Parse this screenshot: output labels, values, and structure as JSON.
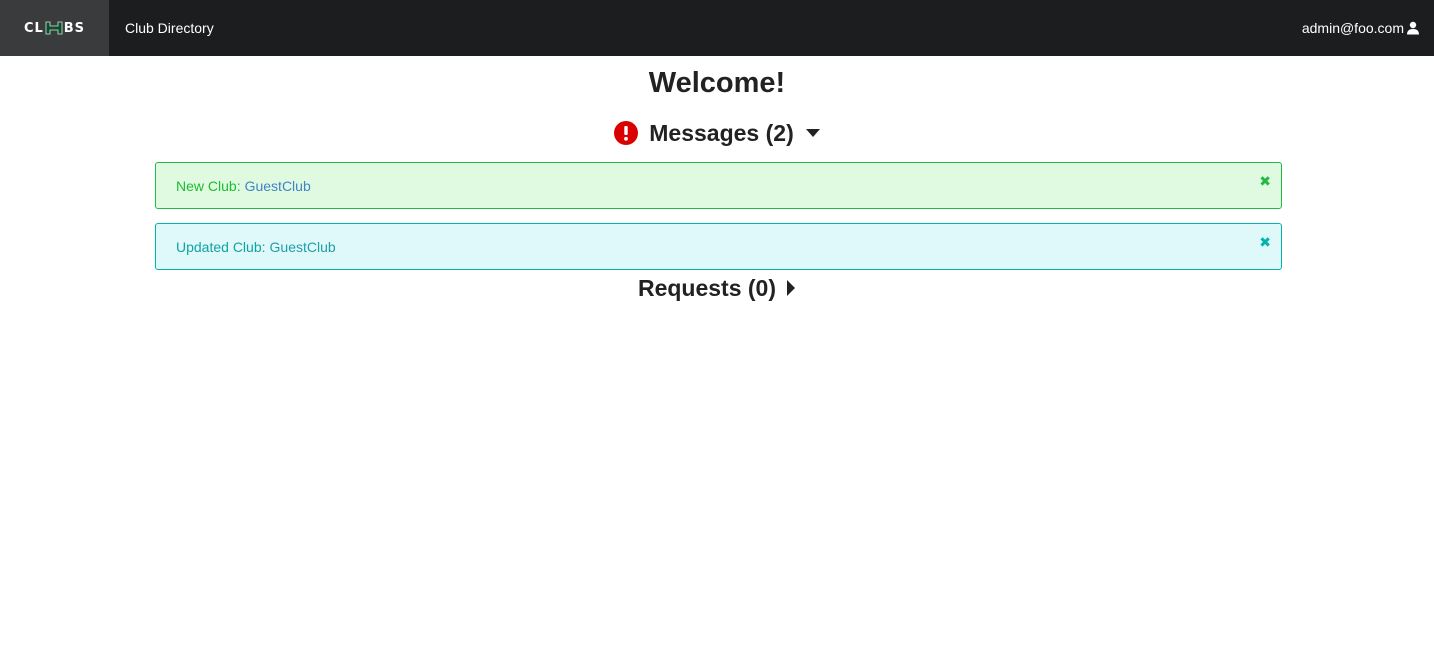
{
  "navbar": {
    "logo_text_left": "CL",
    "logo_text_right": "BS",
    "club_directory_label": "Club Directory",
    "user_email": "admin@foo.com",
    "user_icon": "user-icon"
  },
  "main": {
    "welcome": "Welcome!",
    "messages_header": "Messages (2)",
    "messages_icon": "exclamation-circle-icon",
    "messages_icon_color": "#db0000",
    "requests_header": "Requests (0)",
    "messages": [
      {
        "type": "success",
        "prefix": "New Club:",
        "club": "GuestClub",
        "close": "✖"
      },
      {
        "type": "info",
        "prefix": "Updated Club:",
        "club": "GuestClub",
        "close": "✖"
      }
    ]
  },
  "colors": {
    "navbar_bg": "#1c1d1f",
    "success_bg": "#e0fae2",
    "success_border": "#21ba45",
    "info_bg": "#dff8f9",
    "info_border": "#00b5ad"
  }
}
